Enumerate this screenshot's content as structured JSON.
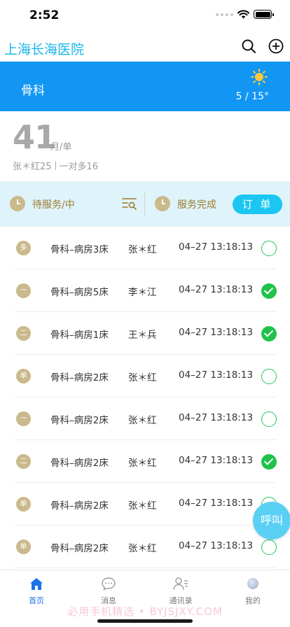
{
  "status": {
    "time": "2:52"
  },
  "header": {
    "title": "上海长海医院"
  },
  "banner": {
    "department": "骨科",
    "temperature": "5 / 15°"
  },
  "stats": {
    "count": "41",
    "unit": "月/单",
    "meta_a": "张＊红25",
    "meta_b": "一对多16"
  },
  "filter": {
    "pending_label": "待服务/中",
    "done_label": "服务完成",
    "order_button": "订 单"
  },
  "orders": [
    {
      "badge": "多",
      "room": "骨科–病房3床",
      "patient": "张＊红",
      "time": "04–27 13:18:13",
      "done": false
    },
    {
      "badge": "一",
      "room": "骨科–病房5床",
      "patient": "李＊江",
      "time": "04–27 13:18:13",
      "done": true
    },
    {
      "badge": "二",
      "room": "骨科–病房1床",
      "patient": "王＊兵",
      "time": "04–27 13:18:13",
      "done": true
    },
    {
      "badge": "单",
      "room": "骨科–病房2床",
      "patient": "张＊红",
      "time": "04–27 13:18:13",
      "done": false
    },
    {
      "badge": "一",
      "room": "骨科–病房2床",
      "patient": "张＊红",
      "time": "04–27 13:18:13",
      "done": false
    },
    {
      "badge": "二",
      "room": "骨科–病房2床",
      "patient": "张＊红",
      "time": "04–27 13:18:13",
      "done": true
    },
    {
      "badge": "单",
      "room": "骨科–病房2床",
      "patient": "张＊红",
      "time": "04–27 13:18:13",
      "done": false
    },
    {
      "badge": "单",
      "room": "骨科–病房2床",
      "patient": "张＊红",
      "time": "04–27 13:18:13",
      "done": false
    }
  ],
  "call_button": "呼叫",
  "tabs": [
    {
      "label": "首页",
      "icon": "home-icon",
      "active": true
    },
    {
      "label": "消息",
      "icon": "message-icon",
      "active": false
    },
    {
      "label": "通讯录",
      "icon": "contacts-icon",
      "active": false
    },
    {
      "label": "我的",
      "icon": "profile-icon",
      "active": false
    }
  ],
  "watermark": "必用手机精选 • BYJSJXY.COM",
  "colors": {
    "accent": "#1296f3",
    "title": "#19b6ea",
    "badge": "#c9b98c",
    "check": "#1fc34a",
    "order_button": "#1cc6f2"
  }
}
